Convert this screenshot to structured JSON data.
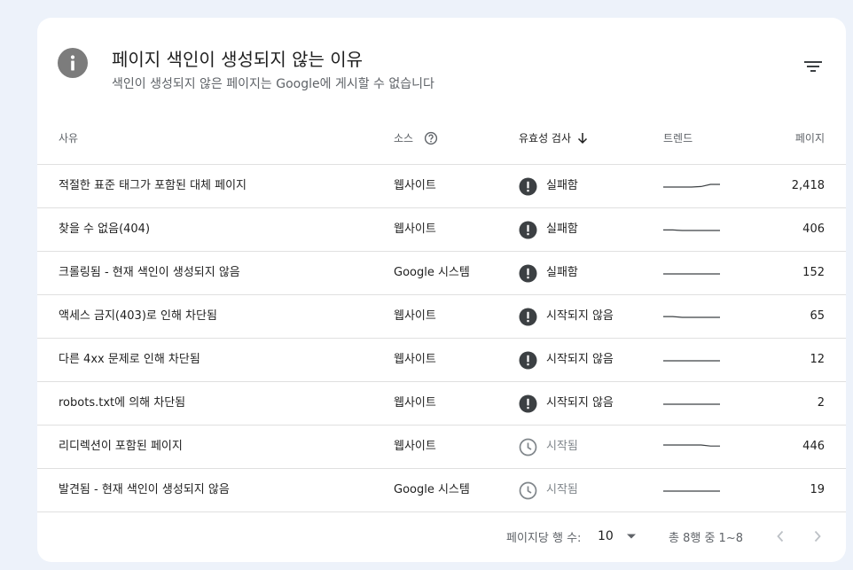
{
  "header": {
    "title": "페이지 색인이 생성되지 않는 이유",
    "subtitle": "색인이 생성되지 않은 페이지는 Google에 게시할 수 없습니다"
  },
  "table": {
    "columns": {
      "reason": "사유",
      "source": "소스",
      "validation": "유효성 검사",
      "trend": "트렌드",
      "pages": "페이지"
    },
    "rows": [
      {
        "reason": "적절한 표준 태그가 포함된 대체 페이지",
        "source": "웹사이트",
        "status": "실패함",
        "status_icon": "error-icon",
        "pages": "2,418",
        "trend": [
          0,
          0,
          0,
          0,
          0.2,
          1,
          1
        ]
      },
      {
        "reason": "찾을 수 없음(404)",
        "source": "웹사이트",
        "status": "실패함",
        "status_icon": "error-icon",
        "pages": "406",
        "trend": [
          0.2,
          0.2,
          0,
          0,
          0,
          0,
          0
        ]
      },
      {
        "reason": "크롤링됨 - 현재 색인이 생성되지 않음",
        "source": "Google 시스템",
        "status": "실패함",
        "status_icon": "error-icon",
        "pages": "152",
        "trend": [
          0,
          0,
          0,
          0,
          0,
          0,
          0
        ]
      },
      {
        "reason": "액세스 금지(403)로 인해 차단됨",
        "source": "웹사이트",
        "status": "시작되지 않음",
        "status_icon": "error-icon",
        "pages": "65",
        "trend": [
          0.3,
          0.3,
          0,
          0,
          0,
          0,
          0
        ]
      },
      {
        "reason": "다른 4xx 문제로 인해 차단됨",
        "source": "웹사이트",
        "status": "시작되지 않음",
        "status_icon": "error-icon",
        "pages": "12",
        "trend": [
          0,
          0,
          0,
          0,
          0,
          0,
          0
        ]
      },
      {
        "reason": "robots.txt에 의해 차단됨",
        "source": "웹사이트",
        "status": "시작되지 않음",
        "status_icon": "error-icon",
        "pages": "2",
        "trend": [
          0,
          0,
          0,
          0,
          0,
          0,
          0
        ]
      },
      {
        "reason": "리디렉션이 포함된 페이지",
        "source": "웹사이트",
        "status": "시작됨",
        "status_icon": "clock-icon",
        "pages": "446",
        "trend": [
          1,
          1,
          1,
          1,
          1,
          0.6,
          0.6
        ]
      },
      {
        "reason": "발견됨 - 현재 색인이 생성되지 않음",
        "source": "Google 시스템",
        "status": "시작됨",
        "status_icon": "clock-icon",
        "pages": "19",
        "trend": [
          0,
          0,
          0,
          0,
          0,
          0,
          0
        ]
      }
    ]
  },
  "footer": {
    "rows_per_page_label": "페이지당 행 수:",
    "rows_per_page_value": "10",
    "range": "총 8행 중 1~8"
  },
  "colors": {
    "error": "#3c4043",
    "neutral": "#80868b",
    "background": "#edf2fa",
    "card": "#ffffff"
  }
}
